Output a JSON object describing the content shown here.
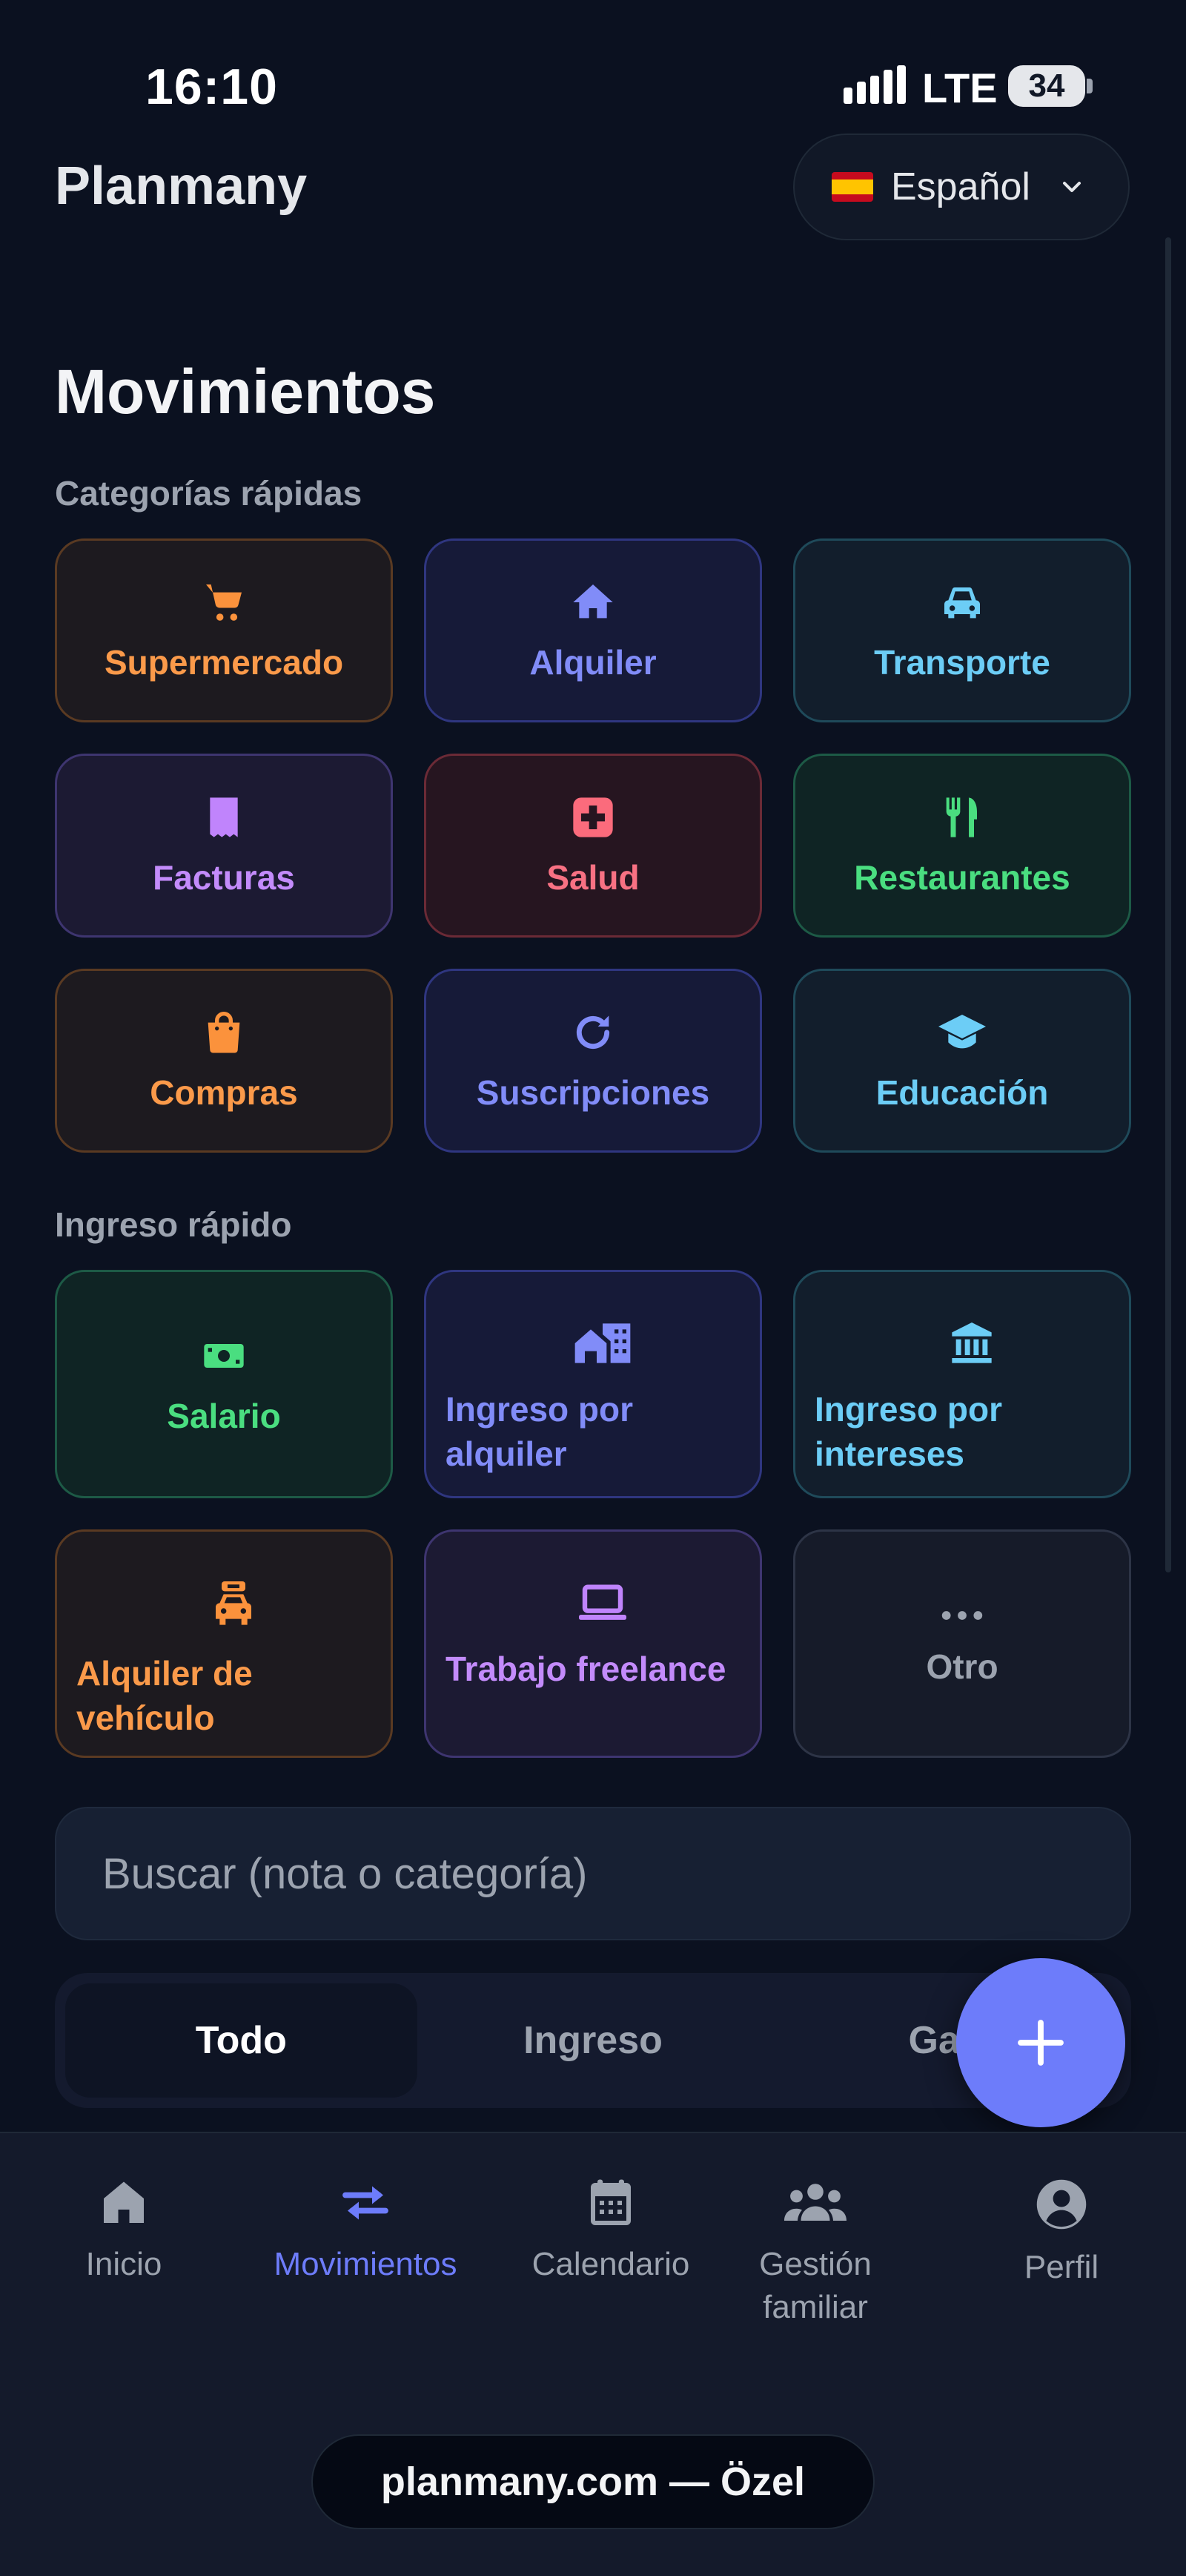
{
  "status_bar": {
    "time": "16:10",
    "network": "LTE",
    "battery": "34"
  },
  "header": {
    "app_title": "Planmany",
    "language": "Español"
  },
  "page": {
    "title": "Movimientos"
  },
  "quick_categories": {
    "label": "Categorías rápidas",
    "items": [
      {
        "label": "Supermercado",
        "icon": "cart-icon"
      },
      {
        "label": "Alquiler",
        "icon": "home-icon"
      },
      {
        "label": "Transporte",
        "icon": "car-icon"
      },
      {
        "label": "Facturas",
        "icon": "receipt-icon"
      },
      {
        "label": "Salud",
        "icon": "medical-icon"
      },
      {
        "label": "Restaurantes",
        "icon": "utensils-icon"
      },
      {
        "label": "Compras",
        "icon": "shopping-bag-icon"
      },
      {
        "label": "Suscripciones",
        "icon": "refresh-icon"
      },
      {
        "label": "Educación",
        "icon": "graduation-cap-icon"
      }
    ]
  },
  "quick_income": {
    "label": "Ingreso rápido",
    "items": [
      {
        "label": "Salario",
        "icon": "money-icon"
      },
      {
        "label": "Ingreso por alquiler",
        "icon": "building-icon"
      },
      {
        "label": "Ingreso por intereses",
        "icon": "bank-icon"
      },
      {
        "label": "Alquiler de vehículo",
        "icon": "taxi-icon"
      },
      {
        "label": "Trabajo freelance",
        "icon": "laptop-icon"
      },
      {
        "label": "Otro",
        "icon": "more-icon"
      }
    ]
  },
  "search": {
    "placeholder": "Buscar (nota o categoría)"
  },
  "filter_tabs": [
    "Todo",
    "Ingreso",
    "Gas"
  ],
  "bottom_nav": [
    {
      "label": "Inicio",
      "icon": "home-icon"
    },
    {
      "label": "Movimientos",
      "icon": "transfer-icon"
    },
    {
      "label": "Calendario",
      "icon": "calendar-icon"
    },
    {
      "label": "Gestión familiar",
      "icon": "family-icon"
    },
    {
      "label": "Perfil",
      "icon": "profile-icon"
    }
  ],
  "footer": {
    "domain": "planmany.com — Özel"
  },
  "colors": {
    "accent": "#6d7cfa",
    "background": "#0b1120"
  }
}
